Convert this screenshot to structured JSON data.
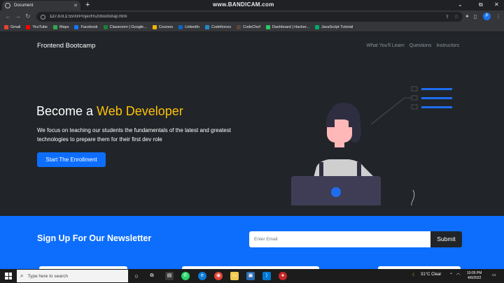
{
  "browser": {
    "tab_title": "Document",
    "watermark": "www.BANDICAM.com",
    "url_host": "127.0.0.1",
    "url_rest": ":5500/Project%20bootstrap.html",
    "bookmarks": [
      {
        "label": "Gmail",
        "color": "#ea4335"
      },
      {
        "label": "YouTube",
        "color": "#ff0000"
      },
      {
        "label": "Maps",
        "color": "#34a853"
      },
      {
        "label": "Facebook",
        "color": "#1877f2"
      },
      {
        "label": "Classroom | Google...",
        "color": "#188038"
      },
      {
        "label": "Courses",
        "color": "#f4b400"
      },
      {
        "label": "LinkedIn",
        "color": "#0a66c2"
      },
      {
        "label": "Codeforces",
        "color": "#1f8acb"
      },
      {
        "label": "CodeChef",
        "color": "#5b4638"
      },
      {
        "label": "Dashboard | Hacker...",
        "color": "#2ec866"
      },
      {
        "label": "JavaScript Tutorial",
        "color": "#04aa6d"
      }
    ],
    "profile_initial": "P"
  },
  "navbar": {
    "brand": "Frontend Bootcamp",
    "links": [
      "What You'll Learn",
      "Questions",
      "Instructors"
    ]
  },
  "hero": {
    "title_prefix": "Become a ",
    "title_accent": "Web Developer",
    "text": "We focus on teaching our students the fundamentals of the latest and greatest technologies to prepare them for their first dev role",
    "cta": "Start The Enrollment"
  },
  "newsletter": {
    "title": "Sign Up For Our Newsletter",
    "placeholder": "Enter Email",
    "button": "Submit"
  },
  "taskbar": {
    "search_placeholder": "Type here to search",
    "weather": "31°C Clear",
    "time": "10:05 PM",
    "date": "4/6/2022"
  },
  "colors": {
    "accent": "#ffc107",
    "primary": "#0d6efd",
    "dark": "#212529"
  }
}
